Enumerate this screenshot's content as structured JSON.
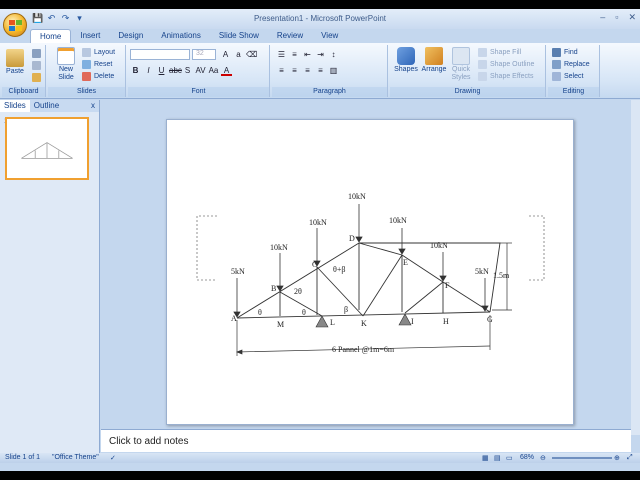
{
  "window": {
    "title": "Presentation1 - Microsoft PowerPoint",
    "controls": [
      "–",
      "▫",
      "✕"
    ]
  },
  "quick_access": {
    "save_icon": "save-icon",
    "undo_icon": "undo-icon",
    "redo_icon": "redo-icon"
  },
  "tabs": [
    "Home",
    "Insert",
    "Design",
    "Animations",
    "Slide Show",
    "Review",
    "View"
  ],
  "ribbon": {
    "clipboard": {
      "label": "Clipboard",
      "paste": "Paste"
    },
    "slides": {
      "label": "Slides",
      "new_slide_l1": "New",
      "new_slide_l2": "Slide",
      "layout": "Layout",
      "reset": "Reset",
      "delete": "Delete"
    },
    "font": {
      "label": "Font",
      "size": "32"
    },
    "paragraph": {
      "label": "Paragraph"
    },
    "drawing": {
      "label": "Drawing",
      "shapes": "Shapes",
      "arrange": "Arrange",
      "quick_styles_l1": "Quick",
      "quick_styles_l2": "Styles",
      "shape_fill": "Shape Fill",
      "shape_outline": "Shape Outline",
      "shape_effects": "Shape Effects"
    },
    "editing": {
      "label": "Editing",
      "find": "Find",
      "replace": "Replace",
      "select": "Select"
    }
  },
  "left_pane": {
    "tab_slides": "Slides",
    "tab_outline": "Outline",
    "close": "x",
    "thumb_number": "1"
  },
  "slide": {
    "loads": {
      "a": "5kN",
      "b": "10kN",
      "c": "10kN",
      "d": "10kN",
      "e": "10kN",
      "f": "10kN",
      "g": "5kN"
    },
    "nodes": {
      "A": "A",
      "B": "B",
      "C": "C",
      "D": "D",
      "E": "E",
      "F": "F",
      "G": "G",
      "H": "H",
      "I": "I",
      "K": "K",
      "L": "L",
      "M": "M"
    },
    "angles": {
      "theta1": "θ",
      "theta2": "θ",
      "two_theta": "2θ",
      "theta_beta": "θ+β",
      "beta": "β"
    },
    "height": "1.5m",
    "span": "6 Pannel @1m=6m"
  },
  "notes": {
    "placeholder": "Click to add notes"
  },
  "status": {
    "slide": "Slide 1 of 1",
    "theme": "\"Office Theme\"",
    "zoom": "68%"
  }
}
